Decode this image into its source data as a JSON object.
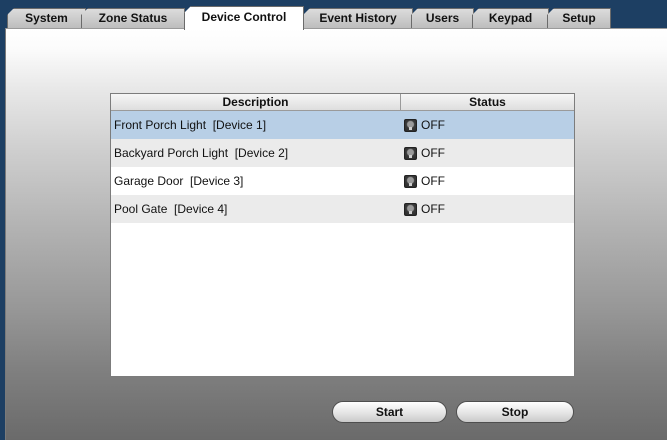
{
  "tabs": [
    {
      "label": "System"
    },
    {
      "label": "Zone Status"
    },
    {
      "label": "Device Control"
    },
    {
      "label": "Event History"
    },
    {
      "label": "Users"
    },
    {
      "label": "Keypad"
    },
    {
      "label": "Setup"
    }
  ],
  "active_tab": "Device Control",
  "table": {
    "headers": {
      "description": "Description",
      "status": "Status"
    },
    "rows": [
      {
        "description": "Front Porch Light  [Device 1]",
        "status": "OFF",
        "status_icon": "bulb-off-icon",
        "selected": true
      },
      {
        "description": "Backyard Porch Light  [Device 2]",
        "status": "OFF",
        "status_icon": "bulb-off-icon",
        "selected": false
      },
      {
        "description": "Garage Door  [Device 3]",
        "status": "OFF",
        "status_icon": "bulb-off-icon",
        "selected": false
      },
      {
        "description": "Pool Gate  [Device 4]",
        "status": "OFF",
        "status_icon": "bulb-off-icon",
        "selected": false
      }
    ]
  },
  "buttons": {
    "start": "Start",
    "stop": "Stop"
  },
  "colors": {
    "tab_bar": "#1d3f63",
    "selected_row": "#b8cfe6",
    "alt_row": "#ebebeb"
  }
}
